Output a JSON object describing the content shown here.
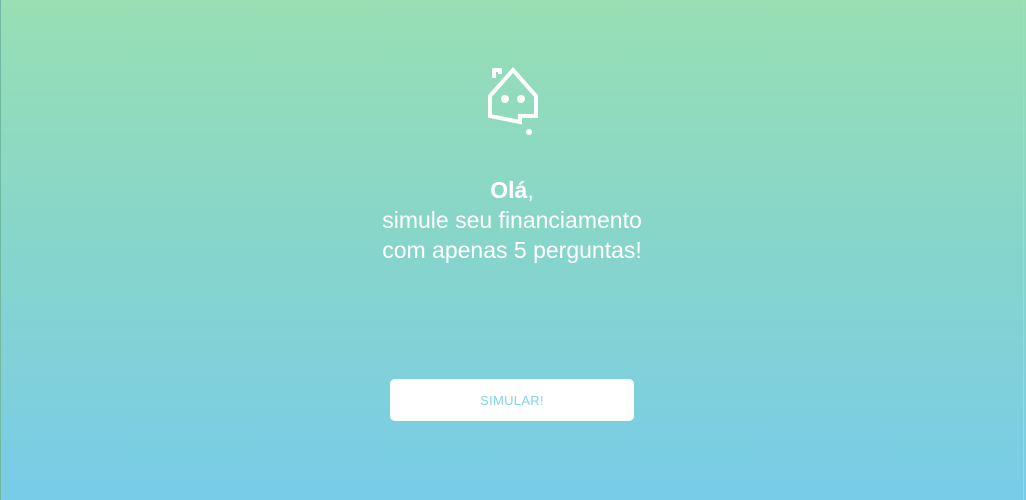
{
  "greeting": {
    "hello": "Olá",
    "comma": ",",
    "line2": "simule seu financiamento",
    "line3": "com apenas 5 perguntas!"
  },
  "actions": {
    "simulate_label": "SIMULAR!"
  },
  "colors": {
    "gradient_top": "#98dfb4",
    "gradient_bottom": "#78cce8",
    "button_text": "#86d3ec"
  },
  "icons": {
    "logo": "house-chat-bot-icon"
  }
}
